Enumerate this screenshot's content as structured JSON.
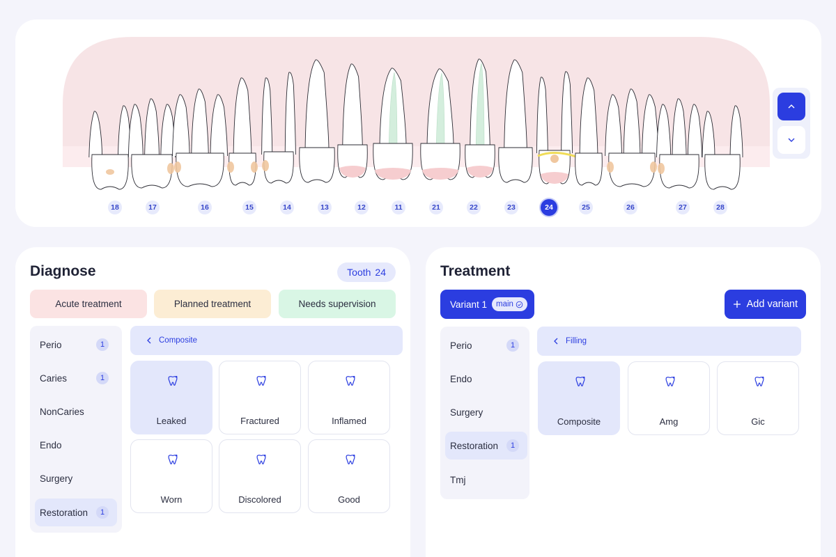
{
  "chart": {
    "teeth": [
      {
        "number": "18",
        "selected": false
      },
      {
        "number": "17",
        "selected": false
      },
      {
        "number": "16",
        "selected": false
      },
      {
        "number": "15",
        "selected": false
      },
      {
        "number": "14",
        "selected": false
      },
      {
        "number": "13",
        "selected": false
      },
      {
        "number": "12",
        "selected": false
      },
      {
        "number": "11",
        "selected": false
      },
      {
        "number": "21",
        "selected": false
      },
      {
        "number": "22",
        "selected": false
      },
      {
        "number": "23",
        "selected": false
      },
      {
        "number": "24",
        "selected": true
      },
      {
        "number": "25",
        "selected": false
      },
      {
        "number": "26",
        "selected": false
      },
      {
        "number": "27",
        "selected": false
      },
      {
        "number": "28",
        "selected": false
      }
    ],
    "jaw_toggle": {
      "up_icon": "chevron-up-icon",
      "down_icon": "chevron-down-icon",
      "active": "upper"
    }
  },
  "diagnose": {
    "title": "Diagnose",
    "tooth_chip": {
      "label": "Tooth",
      "value": "24"
    },
    "statuses": [
      {
        "label": "Acute treatment",
        "color": "#fbe3e3"
      },
      {
        "label": "Planned treatment",
        "color": "#fcedd4"
      },
      {
        "label": "Needs supervision",
        "color": "#d9f6e5"
      }
    ],
    "categories": [
      {
        "label": "Perio",
        "badge": "1",
        "active": false
      },
      {
        "label": "Caries",
        "badge": "1",
        "active": false
      },
      {
        "label": "NonCaries",
        "badge": "",
        "active": false
      },
      {
        "label": "Endo",
        "badge": "",
        "active": false
      },
      {
        "label": "Surgery",
        "badge": "",
        "active": false
      },
      {
        "label": "Restoration",
        "badge": "1",
        "active": true
      }
    ],
    "breadcrumb": "Composite",
    "options": [
      {
        "label": "Leaked",
        "icon": "tooth-icon",
        "active": true
      },
      {
        "label": "Fractured",
        "icon": "tooth-icon",
        "active": false
      },
      {
        "label": "Inflamed",
        "icon": "tooth-icon",
        "active": false
      },
      {
        "label": "Worn",
        "icon": "tooth-icon",
        "active": false
      },
      {
        "label": "Discolored",
        "icon": "tooth-icon",
        "active": false
      },
      {
        "label": "Good",
        "icon": "tooth-icon",
        "active": false
      }
    ]
  },
  "treatment": {
    "title": "Treatment",
    "variant": {
      "label": "Variant 1",
      "tag": "main"
    },
    "add_variant_label": "Add variant",
    "categories": [
      {
        "label": "Perio",
        "badge": "1",
        "active": false
      },
      {
        "label": "Endo",
        "badge": "",
        "active": false
      },
      {
        "label": "Surgery",
        "badge": "",
        "active": false
      },
      {
        "label": "Restoration",
        "badge": "1",
        "active": true
      },
      {
        "label": "Tmj",
        "badge": "",
        "active": false
      }
    ],
    "breadcrumb": "Filling",
    "options": [
      {
        "label": "Composite",
        "icon": "tooth-icon",
        "active": true
      },
      {
        "label": "Amg",
        "icon": "tooth-icon",
        "active": false
      },
      {
        "label": "Gic",
        "icon": "tooth-icon",
        "active": false
      }
    ]
  },
  "colors": {
    "accent": "#2b3de0",
    "gum": "#f7e4e6",
    "root_canal": "#d4eedd",
    "caries": "#f0c79f",
    "filling": "#f6cdcf"
  }
}
